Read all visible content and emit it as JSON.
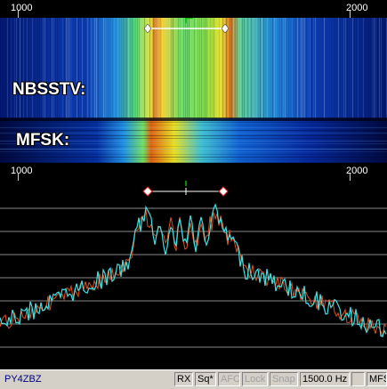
{
  "scale": {
    "start_label": "1000",
    "end_label": "2000"
  },
  "waterfall": {
    "labels": [
      "NBSSTV:",
      "MFSK:"
    ]
  },
  "status": {
    "callsign": "PY4ZBZ",
    "rx": "RX",
    "squelch": "Sq*",
    "afc": "AFC",
    "lock": "Lock",
    "snap": "Snap",
    "frequency": "1500.0 Hz",
    "mode": "MFS"
  },
  "colors": {
    "marker": "#00c000",
    "spectrum_red": "#e05020",
    "spectrum_cyan": "#40e0e0",
    "grid": "#888888"
  }
}
